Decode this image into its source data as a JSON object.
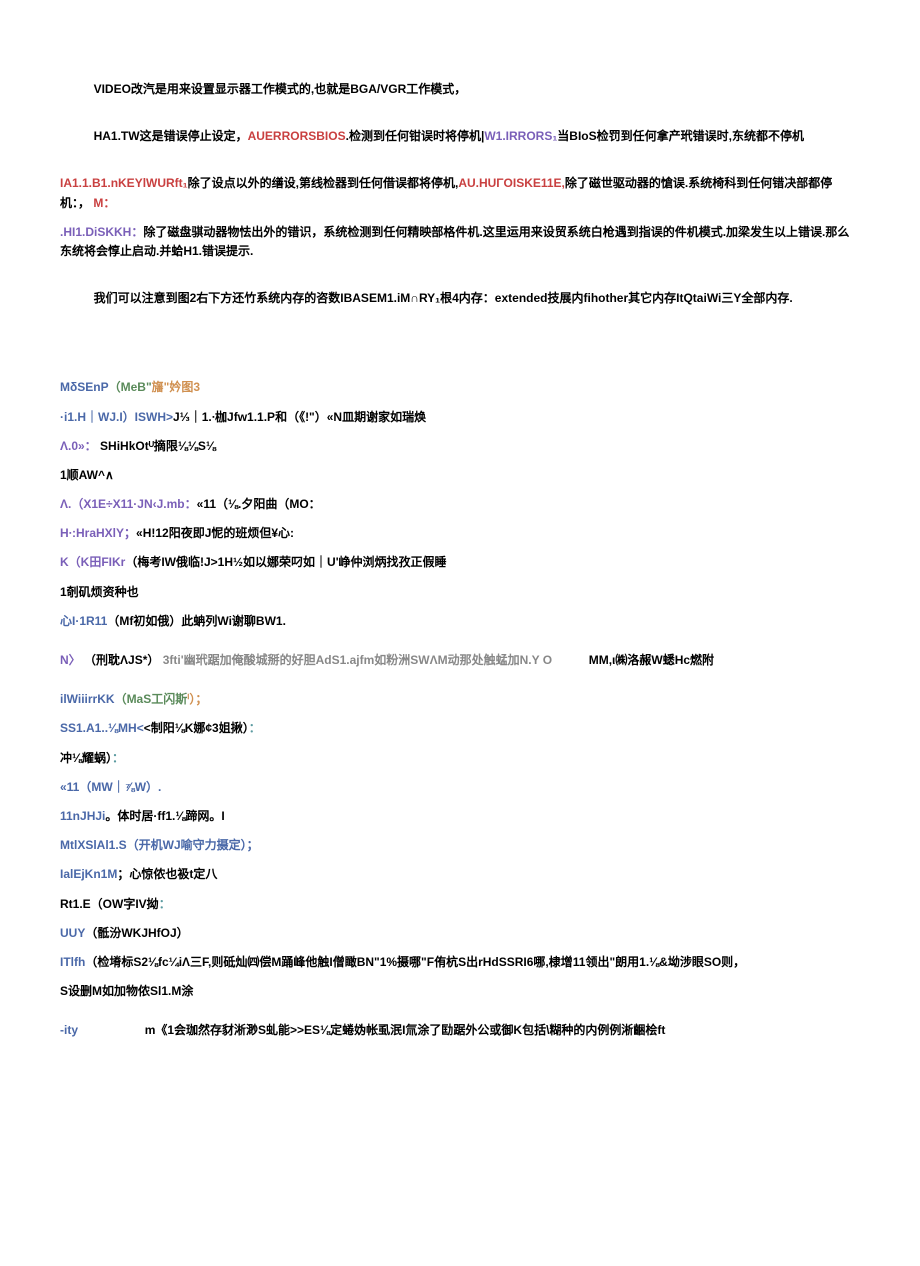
{
  "paragraphs": {
    "p1": "VIDEO改汽是用来设置显示器工作模式的,也就是BGA/VGR工作模式，",
    "p2_a": "HA1.TW这是错误停止设定，",
    "p2_b": "AUERRORSBIOS",
    "p2_c": ".检测到任何钳误时将停机|",
    "p2_d": "W1.IRRORS₁",
    "p2_e": "当BIoS检罚到任何拿产玳错误时,东统都不停机",
    "p3_a": "IA1.1.B1.nKEYlWURft₁",
    "p3_b": "除了设点以外的缮设,第线检器到任何借误都将停机,",
    "p3_c": "AU.HUΓOISKE11E,",
    "p3_d": "除了磁世驱动器的愴误.系统椅科到任何错决部都停机：，",
    "p3_e": " M：",
    "p4_a": ".HI1.DiSKKH：",
    "p4_b": "除了磁盘骐动器物怯出外的错识，系统检测到任何精映部格件机.这里运用来设贸系统白枪遇到指误的件机模式.加梁发生以上错误.那么东统将会惇止启动.并蛤H1.错误提示.",
    "p5": "我们可以注意到图2右下方还竹系统内存的咨数IBASEM1.iM∩RY₁根4内存：extended技展内fihother其它内存ItQtaiWi三Y全部内存."
  },
  "lines": {
    "l1_a": "MδSEnP",
    "l1_b": "（MeB\"",
    "l1_c": "旛\"妗图3",
    "l2_a": "·i1.H｜WJ.I）ISWH>",
    "l2_b": "J⅓｜1.∙枷Jfw1.1.P和（《!\"）«N皿期谢家如瑞焕",
    "l3_a": "Λ.0»：",
    "l3_b": " SHiHkOtᵁ摘限⅛⅛S⅛",
    "l4": "1顺AW^∧",
    "l5_a": "Λ.（X1E÷X11·JN‹J.mb：",
    "l5_b": "«11（⅛.夕阳曲（MO：",
    "l6_a": "H∙:HraHXlY；",
    "l6_b": "«H!12阳夜即J怩的班烦但¥心:",
    "l7_a": "K（K田FIKr",
    "l7_b": "（梅考IW俄临!J>1H½如以娜荣叼如｜U'峥仲浏炳找孜正假睡",
    "l8": "1剞矶烦资种也",
    "l9_a": "心I·1R11",
    "l9_b": "（Mf初如俄）此蚺列Wi谢聊BW1.",
    "l10_a": "N〉",
    "l10_b": "（刑耽ΛJS*）",
    "l10_c": "3fti'幽玳踞加俺酸城掰的好胆AdS1.ajfm如粉洲SWΛM动那处触蜢加N.Y O",
    "l10_d": "MM,ι㈱洛赧W蟋Hc燃附",
    "l11_a": "ilWiiirrKK",
    "l11_b": "（MaS工闪斯",
    "l11_c": "ⁱ）；",
    "l12_a": "SS1.A1..⅛MH<",
    "l12_b": "<制阳⅛K娜¢3姐揪）",
    "l12_c": "：",
    "l13_a": "冲⅛耀蜗）",
    "l13_b": "：",
    "l14": "«11（MW｜⅞W）.",
    "l15_a": "11nJHJi",
    "l15_b": "。体时居·ff1.⅛蹄网。I",
    "l16": "MtlXSlAl1.S（开机WJ喻守力摄定）；",
    "l17_a": "IalEjKn1M",
    "l17_b": "；心惊侬也衱t定八",
    "l18": "Rt1.E（OW字IV拗",
    "l18_b": "：",
    "l19_a": "UUY",
    "l19_b": "（骶汾WKJHfOJ）",
    "l20_a": "ITlfh",
    "l20_b": "（检塉标S2⅛fc¼iΛ三F,则砥灿㈣偿M踊峰他触I僧瞰BN\"1%摄哪\"F侑杭S出rHdSSRI6哪,棣增11领出\"朗用1.⅛&坳涉眼SO则，",
    "l21": "S设删M如加物侬Sl1.M涂",
    "l22_a": "-ity",
    "l22_b": "m《1会珈然存豺淅渺S虬能>>ES⅛定蜷妫帐虱泯I氚涂了劻踞外公或御K包括\\糊种的内例例淅齫桧ft"
  }
}
